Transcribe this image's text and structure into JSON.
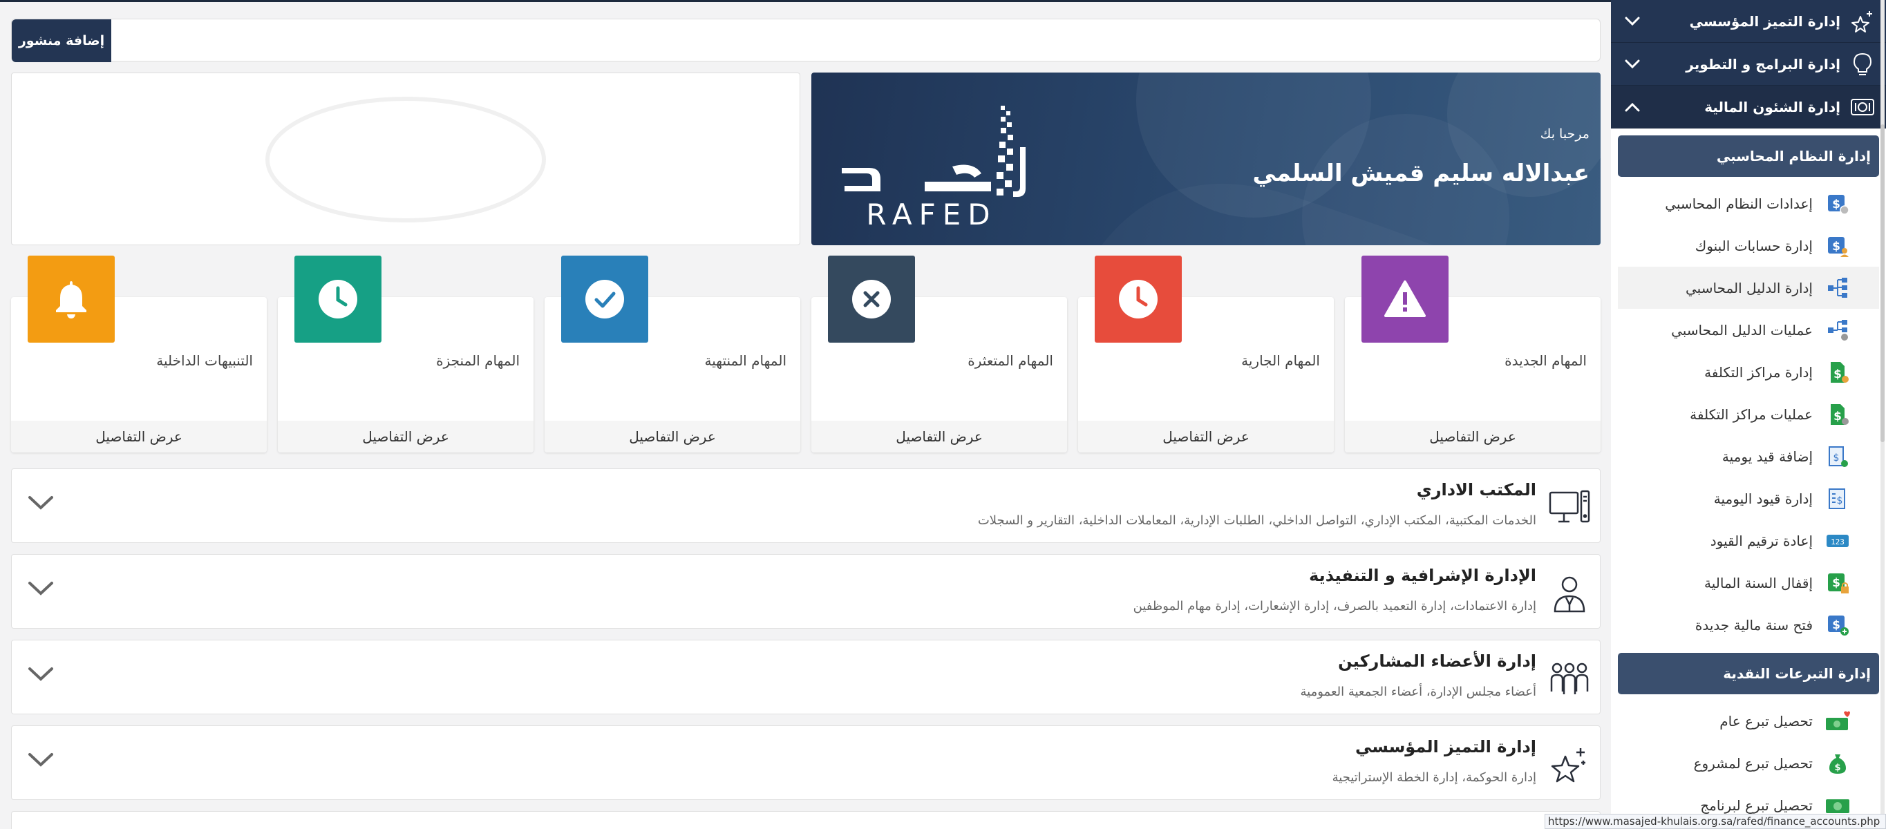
{
  "post": {
    "button_label": "إضافة منشور"
  },
  "banner": {
    "welcome": "مرحبا بك",
    "user_name": "عبدالاله سليم قميش السلمي",
    "logo_text": "RAFED"
  },
  "stats": [
    {
      "title": "المهام الجديدة",
      "footer": "عرض التفاصيل",
      "color": "#8e44ad",
      "icon": "warning-icon"
    },
    {
      "title": "المهام الجارية",
      "footer": "عرض التفاصيل",
      "color": "#e74c3c",
      "icon": "clock-icon"
    },
    {
      "title": "المهام المتعثرة",
      "footer": "عرض التفاصيل",
      "color": "#34495e",
      "icon": "x-circle-icon"
    },
    {
      "title": "المهام المنتهية",
      "footer": "عرض التفاصيل",
      "color": "#2980b9",
      "icon": "check-circle-icon"
    },
    {
      "title": "المهام المنجزة",
      "footer": "عرض التفاصيل",
      "color": "#16a085",
      "icon": "clock-icon"
    },
    {
      "title": "التنبيهات الداخلية",
      "footer": "عرض التفاصيل",
      "color": "#f39c12",
      "icon": "bell-icon"
    }
  ],
  "accordions": [
    {
      "title": "المكتب الاداري",
      "subtitle": "الخدمات المكتبية، المكتب الإداري، التواصل الداخلي، الطلبات الإدارية، المعاملات الداخلية، التقارير و السجلات",
      "icon": "desktop-computer-icon"
    },
    {
      "title": "الإدارة الإشرافية و التنفيذية",
      "subtitle": "إدارة الاعتمادات، إدارة التعميد بالصرف، إدارة الإشعارات، إدارة مهام الموظفين",
      "icon": "manager-user-icon"
    },
    {
      "title": "إدارة الأعضاء المشاركين",
      "subtitle": "أعضاء مجلس الإدارة، أعضاء الجمعية العمومية",
      "icon": "group-users-icon"
    },
    {
      "title": "إدارة التميز المؤسسي",
      "subtitle": "إدارة الحوكمة، إدارة الخطة الإستراتيجية",
      "icon": "star-sparkle-icon"
    }
  ],
  "sidebar": {
    "main_items": [
      {
        "label": "إدارة التميز المؤسسي",
        "icon": "star-sparkle-icon",
        "state": "collapsed"
      },
      {
        "label": "إدارة البرامج و التطوير",
        "icon": "lightbulb-icon",
        "state": "collapsed"
      },
      {
        "label": "إدارة الشئون المالية",
        "icon": "money-icon",
        "state": "expanded"
      }
    ],
    "section_accounting": "إدارة النظام المحاسبي",
    "accounting_items": [
      "إعدادات النظام المحاسبي",
      "إدارة حسابات البنوك",
      "إدارة الدليل المحاسبي",
      "عمليات الدليل المحاسبي",
      "إدارة مراكز التكلفة",
      "عمليات مراكز التكلفة",
      "إضافة قيد يومية",
      "إدارة قيود اليومية",
      "إعادة ترقيم القيود",
      "إقفال السنة المالية",
      "فتح سنة مالية جديدة"
    ],
    "section_donations": "إدارة التبرعات النقدية",
    "donation_items": [
      "تحصيل تبرع عام",
      "تحصيل تبرع لمشروع",
      "تحصيل تبرع لبرنامج"
    ]
  },
  "status_url": "https://www.masajed-khulais.org.sa/rafed/finance_accounts.php"
}
